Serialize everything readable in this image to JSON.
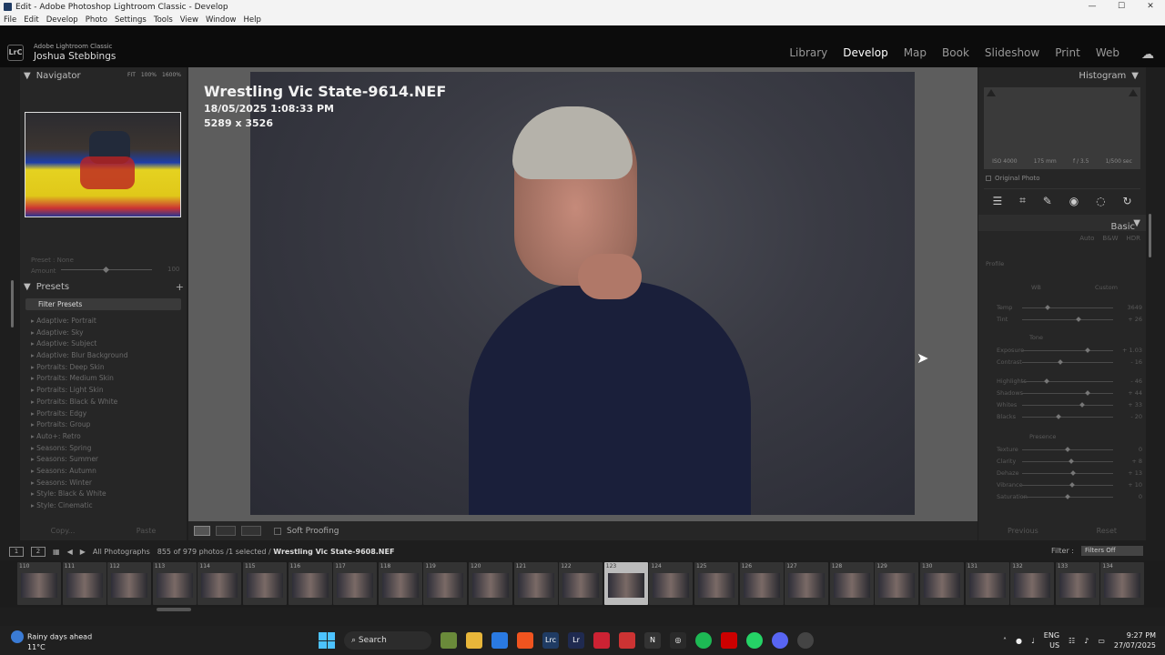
{
  "window": {
    "title": "Edit - Adobe Photoshop Lightroom Classic - Develop"
  },
  "menu": [
    "File",
    "Edit",
    "Develop",
    "Photo",
    "Settings",
    "Tools",
    "View",
    "Window",
    "Help"
  ],
  "identity": {
    "logo": "LrC",
    "app": "Adobe Lightroom Classic",
    "user": "Joshua Stebbings"
  },
  "modules": [
    "Library",
    "Develop",
    "Map",
    "Book",
    "Slideshow",
    "Print",
    "Web"
  ],
  "active_module": "Develop",
  "navigator": {
    "title": "Navigator",
    "opts": [
      "FIT",
      "100%",
      "1600%"
    ]
  },
  "preset_amount": {
    "preset_label": "Preset : None",
    "amount_label": "Amount",
    "value": "100"
  },
  "presets": {
    "title": "Presets",
    "filter": "Filter Presets",
    "items": [
      "Adaptive: Portrait",
      "Adaptive: Sky",
      "Adaptive: Subject",
      "Adaptive: Blur Background",
      "Portraits: Deep Skin",
      "Portraits: Medium Skin",
      "Portraits: Light Skin",
      "Portraits: Black & White",
      "Portraits: Edgy",
      "Portraits: Group",
      "Auto+: Retro",
      "Seasons: Spring",
      "Seasons: Summer",
      "Seasons: Autumn",
      "Seasons: Winter",
      "Style: Black & White",
      "Style: Cinematic"
    ]
  },
  "left_buttons": {
    "copy": "Copy...",
    "paste": "Paste"
  },
  "photo": {
    "filename": "Wrestling Vic State-9614.NEF",
    "datetime": "18/05/2025 1:08:33 PM",
    "dimensions": "5289 x 3526"
  },
  "toolbar": {
    "soft_proofing": "Soft Proofing"
  },
  "histogram": {
    "title": "Histogram",
    "iso": "ISO 4000",
    "focal": "175 mm",
    "aperture": "f / 3.5",
    "shutter": "1/500 sec",
    "original": "Original Photo"
  },
  "basic": {
    "title": "Basic",
    "treatments": [
      "Auto",
      "B&W",
      "HDR"
    ],
    "profile_label": "Profile",
    "wb_label": "WB",
    "wb_value": "Custom",
    "tone_label": "Tone",
    "presence_label": "Presence",
    "sliders_wb": [
      {
        "label": "Temp",
        "value": "3649",
        "pos": 0.28
      },
      {
        "label": "Tint",
        "value": "+ 26",
        "pos": 0.62
      }
    ],
    "sliders_tone1": [
      {
        "label": "Exposure",
        "value": "+ 1.03",
        "pos": 0.72
      },
      {
        "label": "Contrast",
        "value": "- 16",
        "pos": 0.42
      }
    ],
    "sliders_tone2": [
      {
        "label": "Highlights",
        "value": "- 46",
        "pos": 0.27
      },
      {
        "label": "Shadows",
        "value": "+ 44",
        "pos": 0.72
      },
      {
        "label": "Whites",
        "value": "+ 33",
        "pos": 0.66
      },
      {
        "label": "Blacks",
        "value": "- 20",
        "pos": 0.4
      }
    ],
    "sliders_presence": [
      {
        "label": "Texture",
        "value": "0",
        "pos": 0.5
      },
      {
        "label": "Clarity",
        "value": "+ 8",
        "pos": 0.54
      },
      {
        "label": "Dehaze",
        "value": "+ 13",
        "pos": 0.56
      },
      {
        "label": "Vibrance",
        "value": "+ 10",
        "pos": 0.55
      },
      {
        "label": "Saturation",
        "value": "0",
        "pos": 0.5
      }
    ]
  },
  "right_buttons": {
    "previous": "Previous",
    "reset": "Reset"
  },
  "filmstrip_bar": {
    "page1": "1",
    "page2": "2",
    "source": "All Photographs",
    "count": "855 of 979 photos /1 selected /",
    "selected": "Wrestling Vic State-9608.NEF",
    "filter_label": "Filter :",
    "filter_value": "Filters Off"
  },
  "filmstrip": {
    "numbers": [
      "110",
      "111",
      "112",
      "113",
      "114",
      "115",
      "116",
      "117",
      "118",
      "119",
      "120",
      "121",
      "122",
      "123",
      "124",
      "125",
      "126",
      "127",
      "128",
      "129",
      "130",
      "131",
      "132",
      "133",
      "134"
    ],
    "selected_index": 13
  },
  "taskbar": {
    "weather_title": "Rainy days ahead",
    "weather_temp": "11°C",
    "search": "Search",
    "lang": "ENG",
    "region": "US",
    "time": "9:27 PM",
    "date": "27/07/2025"
  }
}
